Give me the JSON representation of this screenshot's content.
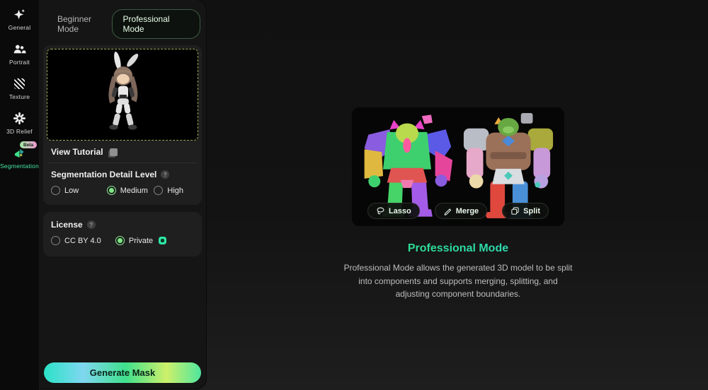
{
  "sidebar": {
    "items": [
      {
        "label": "General"
      },
      {
        "label": "Portrait"
      },
      {
        "label": "Texture"
      },
      {
        "label": "3D Relief"
      },
      {
        "label": "Segmentation",
        "badge": "Beta",
        "active": true
      }
    ]
  },
  "panel": {
    "tabs": [
      {
        "label": "Beginner Mode",
        "active": false
      },
      {
        "label": "Professional Mode",
        "active": true
      }
    ],
    "tutorial": {
      "label": "View Tutorial"
    },
    "help_glyph": "?",
    "detail_section": {
      "title": "Segmentation Detail Level",
      "options": [
        "Low",
        "Medium",
        "High"
      ],
      "selected": "Medium"
    },
    "license_section": {
      "title": "License",
      "options": [
        "CC BY 4.0",
        "Private"
      ],
      "selected": "Private"
    },
    "generate_button_label": "Generate Mask"
  },
  "showcase": {
    "tool_buttons": [
      {
        "label": "Lasso"
      },
      {
        "label": "Merge"
      },
      {
        "label": "Split"
      }
    ],
    "title": "Professional Mode",
    "description": "Professional Mode allows the generated 3D model to be split into components and supports merging, splitting, and adjusting component boundaries."
  },
  "colors": {
    "accent_green": "#3fe081",
    "accent_teal": "#2cd9c0",
    "button_gradient": [
      "#2be2c6",
      "#7fd7f0",
      "#3fe08d",
      "#cdf06a",
      "#4fe69e"
    ]
  }
}
